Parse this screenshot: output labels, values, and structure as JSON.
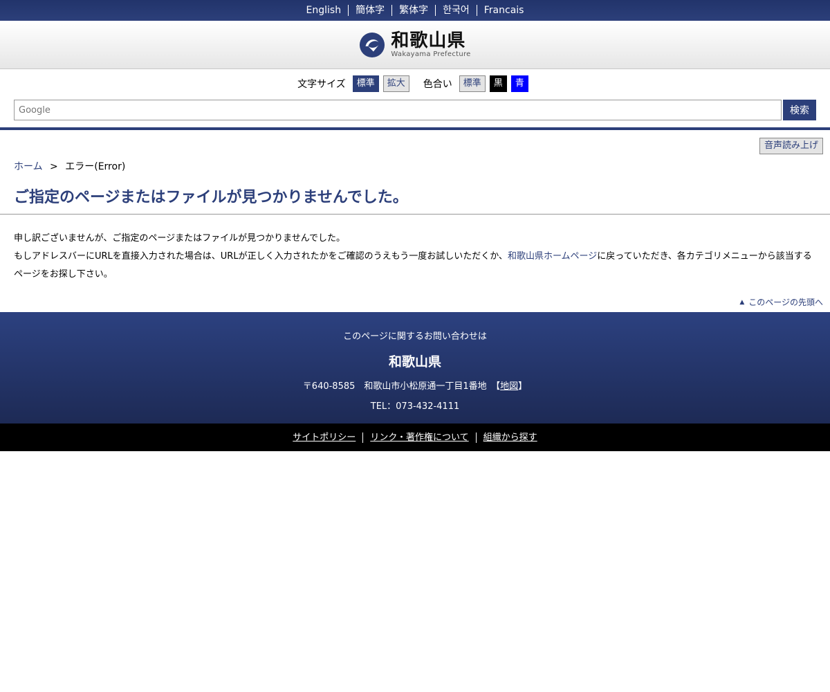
{
  "languages": [
    "English",
    "簡体字",
    "繁体字",
    "한국어",
    "Francais"
  ],
  "header": {
    "logo_jp": "和歌山県",
    "logo_en": "Wakayama Prefecture"
  },
  "tools": {
    "text_size_label": "文字サイズ",
    "text_standard": "標準",
    "text_large": "拡大",
    "color_label": "色合い",
    "color_standard": "標準",
    "color_black": "黒",
    "color_blue": "青"
  },
  "search": {
    "placeholder": "Google",
    "button": "検索"
  },
  "read_aloud": "音声読み上げ",
  "breadcrumb": {
    "home": "ホーム",
    "separator": ">",
    "current": "エラー(Error)"
  },
  "page_title": "ご指定のページまたはファイルが見つかりませんでした。",
  "content": {
    "line1": "申し訳ございませんが、ご指定のページまたはファイルが見つかりませんでした。",
    "line2_before": "もしアドレスバーにURLを直接入力された場合は、URLが正しく入力されたかをご確認のうえもう一度お試しいただくか、",
    "line2_link": "和歌山県ホームページ",
    "line2_after": "に戻っていただき、各カテゴリメニューから該当するページをお探し下さい。"
  },
  "to_top": "このページの先頭へ",
  "footer": {
    "heading": "このページに関するお問い合わせは",
    "org": "和歌山県",
    "address": "〒640-8585　和歌山市小松原通一丁目1番地　【",
    "map_link": "地図",
    "address_end": "】",
    "tel": "TEL：073-432-4111"
  },
  "bottom_links": [
    "サイトポリシー",
    "リンク・著作権について",
    "組織から探す"
  ],
  "colors": {
    "primary": "#2c3f7a",
    "footer_dark": "#1d2a55",
    "black_theme": "#000000",
    "blue_theme": "#0000ff"
  }
}
